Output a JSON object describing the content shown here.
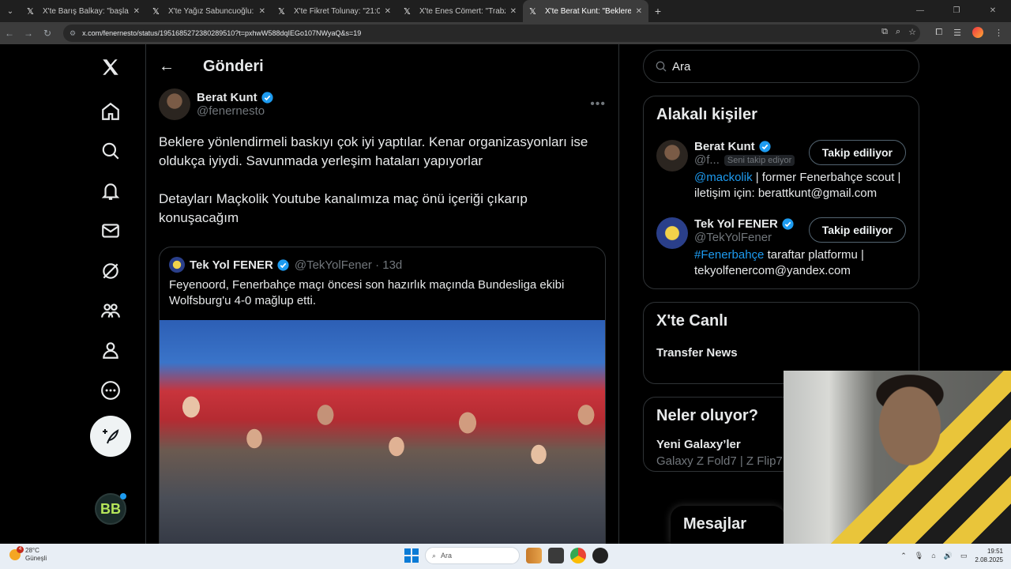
{
  "browser": {
    "tabs": [
      {
        "title": "X'te Barış Balkay: \"başladık.\" / X"
      },
      {
        "title": "X'te Yağız Sabuncuoğlu: \"Kerem"
      },
      {
        "title": "X'te Fikret Tolunay: \"21:00-23:00"
      },
      {
        "title": "X'te Enes Cömert: \"Trabzonspor"
      },
      {
        "title": "X'te Berat Kunt: \"Beklere yönlen"
      }
    ],
    "url": "x.com/fenernesto/status/1951685272380289510?t=pxhwW588dqIEGo107NWyaQ&s=19"
  },
  "header": {
    "title": "Gönderi"
  },
  "post": {
    "author_name": "Berat Kunt",
    "author_handle": "@fenernesto",
    "text_1": "Beklere yönlendirmeli baskıyı çok iyi yaptılar. Kenar organizasyonları ise oldukça iyiydi. Savunmada yerleşim hataları yapıyorlar",
    "text_2": "Detayları Maçkolik Youtube kanalımıza maç önü içeriği çıkarıp konuşacağım",
    "quote": {
      "author_name": "Tek Yol FENER",
      "author_handle": "@TekYolFener · 13d",
      "text": "Feyenoord, Fenerbahçe maçı öncesi son hazırlık maçında Bundesliga ekibi Wolfsburg'u 4-0 mağlup etti."
    }
  },
  "sidebar": {
    "search_placeholder": "Ara",
    "related_title": "Alakalı kişiler",
    "people": [
      {
        "name": "Berat Kunt",
        "handle": "@f...",
        "follows_you": "Seni takip ediyor",
        "button": "Takip ediliyor",
        "bio_link": "@mackolik",
        "bio_text": " | former Fenerbahçe scout | iletişim için: berattkunt@gmail.com"
      },
      {
        "name": "Tek Yol FENER",
        "handle": "@TekYolFener",
        "button": "Takip ediliyor",
        "bio_link": "#Fenerbahçe",
        "bio_text": " taraftar platformu | tekyolfenercom@yandex.com"
      }
    ],
    "live_title": "X'te Canlı",
    "live_item": "Transfer News",
    "trends_title": "Neler oluyor?",
    "trend_name": "Yeni Galaxy’ler",
    "trend_sub": "Galaxy Z Fold7 | Z Flip7"
  },
  "messages_label": "Mesajlar",
  "taskbar": {
    "weather_temp": "28°C",
    "weather_desc": "Güneşli",
    "weather_badge": "4",
    "search_label": "Ara",
    "time": "19:51",
    "date": "2.08.2025"
  },
  "colors": {
    "accent": "#1d9bf0",
    "background": "#000000",
    "border": "#2f3336",
    "muted": "#71767b"
  }
}
